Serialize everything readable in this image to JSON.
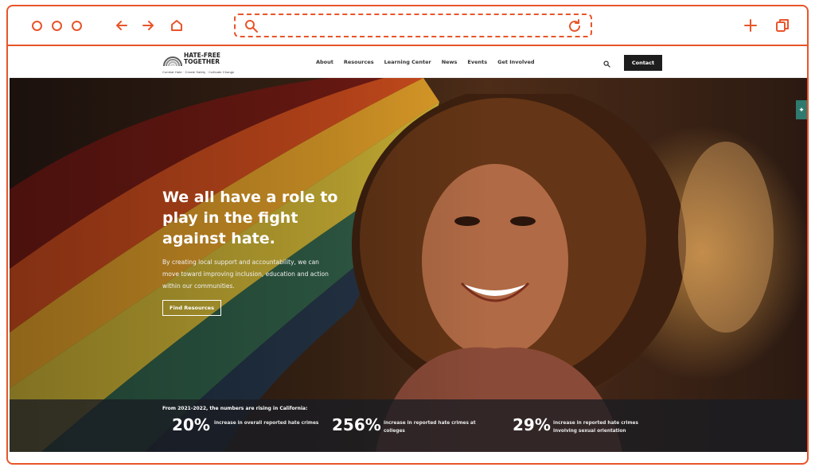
{
  "browser": {
    "url": ""
  },
  "site": {
    "logo": {
      "title": "HATE-FREE TOGETHER",
      "tagline": "Combat Hate · Create Safety · Cultivate Change"
    },
    "nav": [
      {
        "label": "About"
      },
      {
        "label": "Resources"
      },
      {
        "label": "Learning Center"
      },
      {
        "label": "News"
      },
      {
        "label": "Events"
      },
      {
        "label": "Get Involved"
      }
    ],
    "contact_label": "Contact"
  },
  "hero": {
    "title": "We all have a role to play in the fight against hate.",
    "text": "By creating local support and accountability, we can move toward improving inclusion, education and action within our communities.",
    "button_label": "Find Resources"
  },
  "stats": {
    "intro": "From 2021-2022, the numbers are rising in California:",
    "items": [
      {
        "value": "20%",
        "desc": "increase in overall reported hate crimes"
      },
      {
        "value": "256%",
        "desc": "increase in reported hate crimes at colleges"
      },
      {
        "value": "29%",
        "desc": "increase in reported hate crimes involving sexual orientation"
      }
    ]
  },
  "colors": {
    "frame_accent": "#e8552a",
    "contact_button": "#1d1d1d",
    "side_tab": "#2f7a6e"
  }
}
